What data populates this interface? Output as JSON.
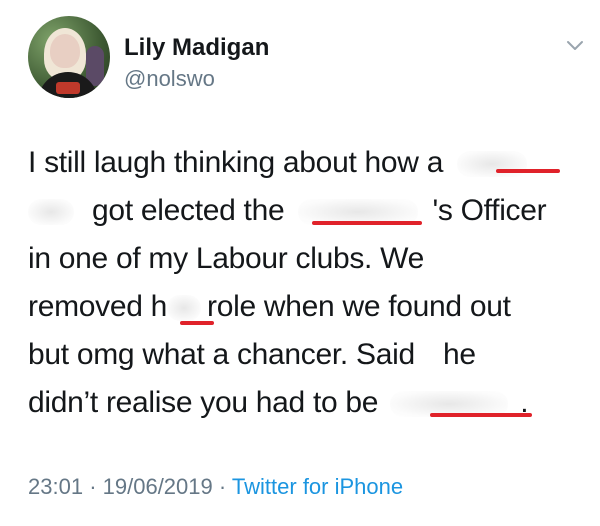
{
  "user": {
    "display_name": "Lily Madigan",
    "handle": "@nolswo",
    "avatar": "profile-photo"
  },
  "menu_icon": "chevron-down-icon",
  "tweet": {
    "lines": [
      {
        "before": "I still laugh thinking about how a",
        "after": ""
      },
      {
        "before": "got elected the",
        "after": "'s Officer"
      },
      {
        "before": "in one of my Labour clubs. We",
        "after": ""
      },
      {
        "before": "removed h",
        "after": "role when we found out"
      },
      {
        "before": "but omg what a chancer. Said",
        "after": "he"
      },
      {
        "before": "didn’t realise you had to be",
        "after": "."
      }
    ]
  },
  "meta": {
    "time": "23:01",
    "separator": "·",
    "date": "19/06/2019",
    "source": "Twitter for iPhone"
  },
  "colors": {
    "text": "#14171a",
    "secondary": "#657786",
    "link": "#1b95e0",
    "redaction_mark": "#e0222a"
  }
}
